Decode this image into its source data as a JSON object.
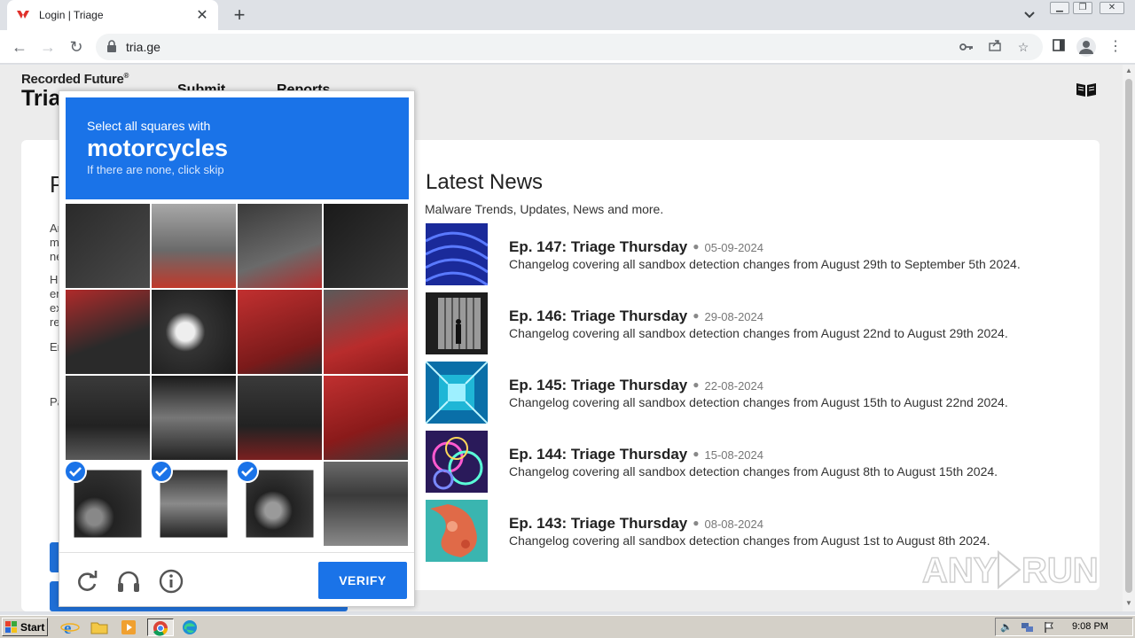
{
  "browser": {
    "tab_title": "Login | Triage",
    "new_tab": "+",
    "close": "✕",
    "url": "tria.ge"
  },
  "page": {
    "brand_top": "Recorded Future",
    "brand_reg": "®",
    "brand_main": "Triage",
    "nav": [
      "Submit",
      "Reports"
    ],
    "login_title": "P"
  },
  "news": {
    "heading": "Latest News",
    "subheading": "Malware Trends, Updates, News and more.",
    "items": [
      {
        "title": "Ep. 147: Triage Thursday",
        "date": "05-09-2024",
        "desc": "Changelog covering all sandbox detection changes from August 29th to September 5th 2024."
      },
      {
        "title": "Ep. 146: Triage Thursday",
        "date": "29-08-2024",
        "desc": "Changelog covering all sandbox detection changes from August 22nd to August 29th 2024."
      },
      {
        "title": "Ep. 145: Triage Thursday",
        "date": "22-08-2024",
        "desc": "Changelog covering all sandbox detection changes from August 15th to August 22nd 2024."
      },
      {
        "title": "Ep. 144: Triage Thursday",
        "date": "15-08-2024",
        "desc": "Changelog covering all sandbox detection changes from August 8th to August 15th 2024."
      },
      {
        "title": "Ep. 143: Triage Thursday",
        "date": "08-08-2024",
        "desc": "Changelog covering all sandbox detection changes from August 1st to August 8th 2024."
      }
    ],
    "thumb_colors": [
      "#2a3fd0",
      "#2b2b2b",
      "#1fb6d6",
      "#6a2ca0",
      "#d9694a"
    ]
  },
  "captcha": {
    "line1": "Select all squares with",
    "line2": "motorcycles",
    "line3": "If there are none, click skip",
    "verify_label": "VERIFY",
    "selected_tiles": [
      12,
      13,
      14
    ],
    "accent_color": "#1a73e8"
  },
  "taskbar": {
    "start_label": "Start",
    "clock": "9:08 PM"
  },
  "watermark": "ANY RUN"
}
